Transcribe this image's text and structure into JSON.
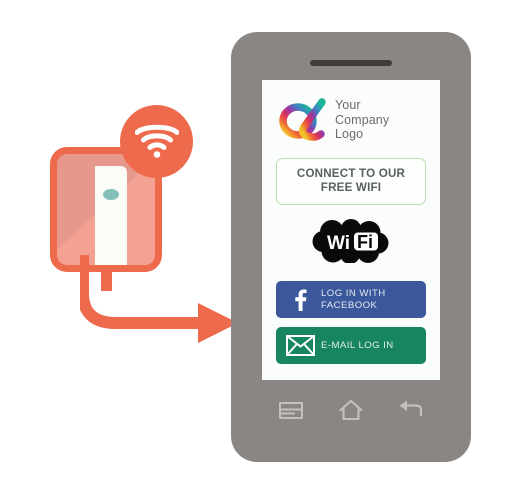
{
  "scene": {
    "title": "Free WiFi captive portal login illustration",
    "background_color": "#ffffff"
  },
  "router": {
    "label": "wifi-router-device",
    "body_color": "#f2a193",
    "border_color": "#ee6a4d",
    "device_color": "#fbfbf8",
    "led_color": "#83bfb8",
    "signal_badge_color": "#ee6a4d",
    "signal_icon": "wifi-signal-icon",
    "cable_color": "#ee6a4d"
  },
  "arrow": {
    "name": "flow-arrow",
    "color": "#ee6a4d",
    "direction": "router-to-phone"
  },
  "phone": {
    "body_color": "#8a8683",
    "screen_color": "#fafdfc",
    "speaker_color": "#3f3c3a",
    "nav": {
      "icons": [
        {
          "name": "recent-apps-icon",
          "label": "Recent apps"
        },
        {
          "name": "home-icon",
          "label": "Home"
        },
        {
          "name": "back-icon",
          "label": "Back"
        }
      ],
      "icon_color": "#c3c0bd"
    }
  },
  "screen": {
    "logo": {
      "mark_name": "company-logo-mark",
      "mark_alt": "gradient alpha symbol",
      "gradient_stops": [
        "#1fb39b",
        "#3f7fc4",
        "#7b3fb0",
        "#cf2a6e",
        "#ef6a34",
        "#f2c12c"
      ],
      "text_lines": [
        "Your",
        "Company",
        "Logo"
      ],
      "text_color": "#6b6b6b"
    },
    "connect_cta": {
      "line1": "CONNECT TO OUR",
      "line2": "FREE WIFI",
      "border_color": "#b5e0ae",
      "text_color": "#5b5f61"
    },
    "wifi_badge": {
      "name": "wifi-certified-logo",
      "text_left": "Wi",
      "text_right": "Fi",
      "color": "#0a0a0a"
    },
    "login_buttons": [
      {
        "id": "facebook",
        "icon": "facebook-f-icon",
        "label_line1": "LOG IN WITH",
        "label_line2": "FACEBOOK",
        "background": "#3a589b",
        "text_color": "#e3e8ef"
      },
      {
        "id": "email",
        "icon": "envelope-icon",
        "label_line1": "E-MAIL LOG IN",
        "label_line2": "",
        "background": "#17855f",
        "text_color": "#e4efea"
      }
    ]
  }
}
